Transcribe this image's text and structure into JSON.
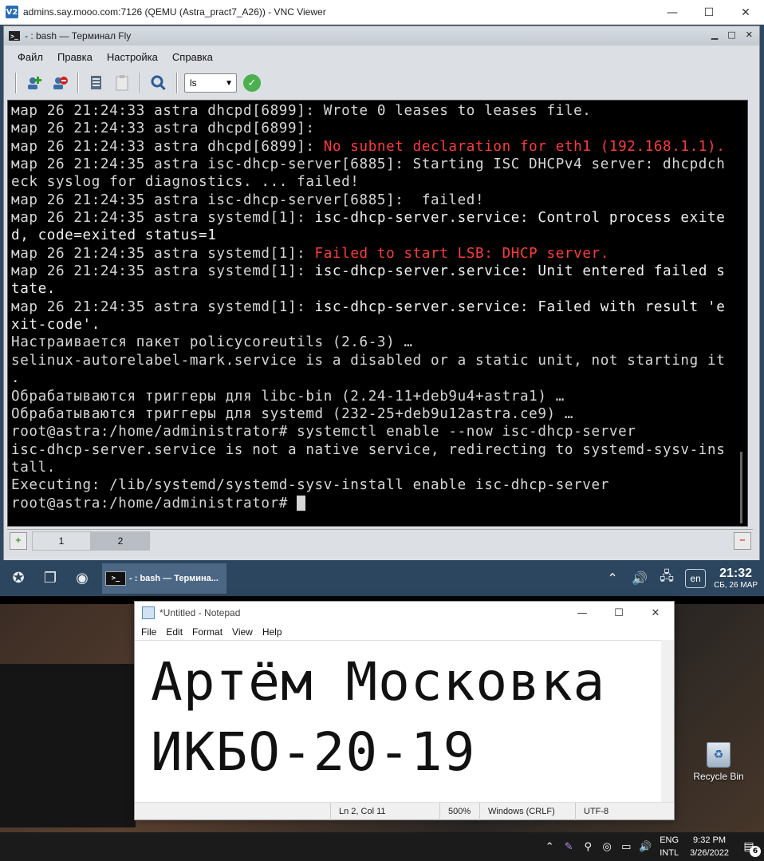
{
  "vnc": {
    "logo": "V2",
    "title": "admins.say.mooo.com:7126 (QEMU (Astra_pract7_A26)) - VNC Viewer",
    "minimize": "—",
    "maximize": "☐",
    "close": "✕"
  },
  "terminal_window": {
    "title": "- : bash — Терминал Fly",
    "title_icon": "terminal-icon",
    "menu": [
      "Файл",
      "Правка",
      "Настройка",
      "Справка"
    ],
    "toolbar": {
      "command_select": "ls",
      "icons": [
        "new-tab-icon",
        "close-tab-icon",
        "copy-icon",
        "paste-icon",
        "search-icon",
        "apply-icon"
      ]
    },
    "lines": [
      {
        "t": "мар 26 21:24:33 astra dhcpd[6899]: Wrote 0 leases to leases file.",
        "hl": ""
      },
      {
        "t": "мар 26 21:24:33 astra dhcpd[6899]:",
        "hl": ""
      },
      {
        "t": "мар 26 21:24:33 astra dhcpd[6899]: ",
        "hl": "No subnet declaration for eth1 (192.168.1.1).",
        "hlc": "red"
      },
      {
        "t": "мар 26 21:24:35 astra isc-dhcp-server[6885]: Starting ISC DHCPv4 server: dhcpdch",
        "hl": ""
      },
      {
        "t": "eck syslog for diagnostics. ... failed!",
        "hl": ""
      },
      {
        "t": "мар 26 21:24:35 astra isc-dhcp-server[6885]:  failed!",
        "hl": ""
      },
      {
        "t": "мар 26 21:24:35 astra systemd[1]: ",
        "hl": "isc-dhcp-server.service: Control process exite",
        "hlc": "bright"
      },
      {
        "t": "",
        "hl": "d, code=exited status=1",
        "hlc": "bright"
      },
      {
        "t": "мар 26 21:24:35 astra systemd[1]: ",
        "hl": "Failed to start LSB: DHCP server.",
        "hlc": "red"
      },
      {
        "t": "мар 26 21:24:35 astra systemd[1]: ",
        "hl": "isc-dhcp-server.service: Unit entered failed s",
        "hlc": "bright"
      },
      {
        "t": "",
        "hl": "tate.",
        "hlc": "bright"
      },
      {
        "t": "мар 26 21:24:35 astra systemd[1]: ",
        "hl": "isc-dhcp-server.service: Failed with result 'e",
        "hlc": "bright"
      },
      {
        "t": "",
        "hl": "xit-code'.",
        "hlc": "bright"
      },
      {
        "t": "Настраивается пакет policycoreutils (2.6-3) …",
        "hl": ""
      },
      {
        "t": "selinux-autorelabel-mark.service is a disabled or a static unit, not starting it",
        "hl": ""
      },
      {
        "t": ".",
        "hl": ""
      },
      {
        "t": "Обрабатываются триггеры для libc-bin (2.24-11+deb9u4+astra1) …",
        "hl": ""
      },
      {
        "t": "Обрабатываются триггеры для systemd (232-25+deb9u12astra.ce9) …",
        "hl": ""
      },
      {
        "t": "root@astra:/home/administrator# systemctl enable --now isc-dhcp-server",
        "hl": ""
      },
      {
        "t": "isc-dhcp-server.service is not a native service, redirecting to systemd-sysv-ins",
        "hl": ""
      },
      {
        "t": "tall.",
        "hl": ""
      },
      {
        "t": "Executing: /lib/systemd/systemd-sysv-install enable isc-dhcp-server",
        "hl": ""
      },
      {
        "t": "root@astra:/home/administrator# ",
        "hl": "",
        "cursor": true
      }
    ],
    "tabs": [
      {
        "label": "1",
        "active": false
      },
      {
        "label": "2",
        "active": true
      }
    ]
  },
  "astra_taskbar": {
    "task_label": "- : bash — Термина...",
    "lang": "en",
    "time": "21:32",
    "date": "СБ, 26 МАР"
  },
  "notepad": {
    "title": "*Untitled - Notepad",
    "menu": [
      "File",
      "Edit",
      "Format",
      "View",
      "Help"
    ],
    "content": [
      "Артём Московка",
      "ИКБО-20-19"
    ],
    "status": {
      "position": "Ln 2, Col 11",
      "zoom": "500%",
      "line_ending": "Windows (CRLF)",
      "encoding": "UTF-8"
    }
  },
  "desktop": {
    "recycle_bin_label": "Recycle Bin"
  },
  "win_taskbar": {
    "lang_top": "ENG",
    "lang_bottom": "INTL",
    "time": "9:32 PM",
    "date": "3/26/2022",
    "notifications": "6"
  }
}
